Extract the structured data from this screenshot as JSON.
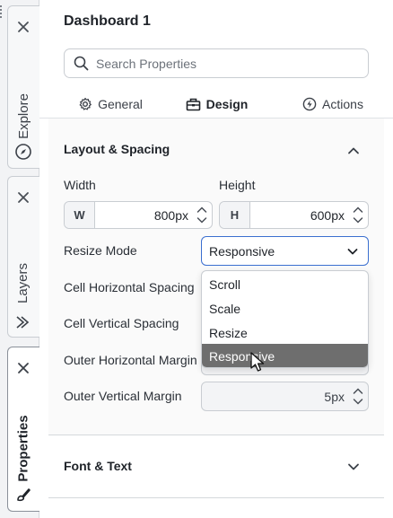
{
  "dock": {
    "tabs": [
      {
        "label": "Explore",
        "icon": "compass-icon",
        "active": false
      },
      {
        "label": "Layers",
        "icon": "layers-icon",
        "active": false
      },
      {
        "label": "Properties",
        "icon": "brush-icon",
        "active": true
      }
    ]
  },
  "panel": {
    "title": "Dashboard 1",
    "search_placeholder": "Search Properties",
    "tabs": [
      {
        "label": "General",
        "icon": "gear-icon"
      },
      {
        "label": "Design",
        "icon": "toolbox-icon",
        "active": true
      },
      {
        "label": "Actions",
        "icon": "bolt-icon"
      }
    ]
  },
  "layout_section": {
    "title": "Layout & Spacing",
    "width_label": "Width",
    "height_label": "Height",
    "width_badge": "W",
    "height_badge": "H",
    "width_value": "800px",
    "height_value": "600px",
    "resize_mode_label": "Resize Mode",
    "resize_mode_value": "Responsive",
    "resize_mode_options": [
      "Scroll",
      "Scale",
      "Resize",
      "Responsive"
    ],
    "highlighted_option": "Responsive",
    "cell_h_spacing_label": "Cell Horizontal Spacing",
    "cell_v_spacing_label": "Cell Vertical Spacing",
    "outer_h_margin_label": "Outer Horizontal Margin",
    "outer_v_margin_label": "Outer Vertical Margin",
    "outer_v_margin_value": "5px"
  },
  "font_section": {
    "title": "Font & Text"
  },
  "colors": {
    "accent": "#3b6fd0",
    "highlight": "#6e6e6e"
  }
}
